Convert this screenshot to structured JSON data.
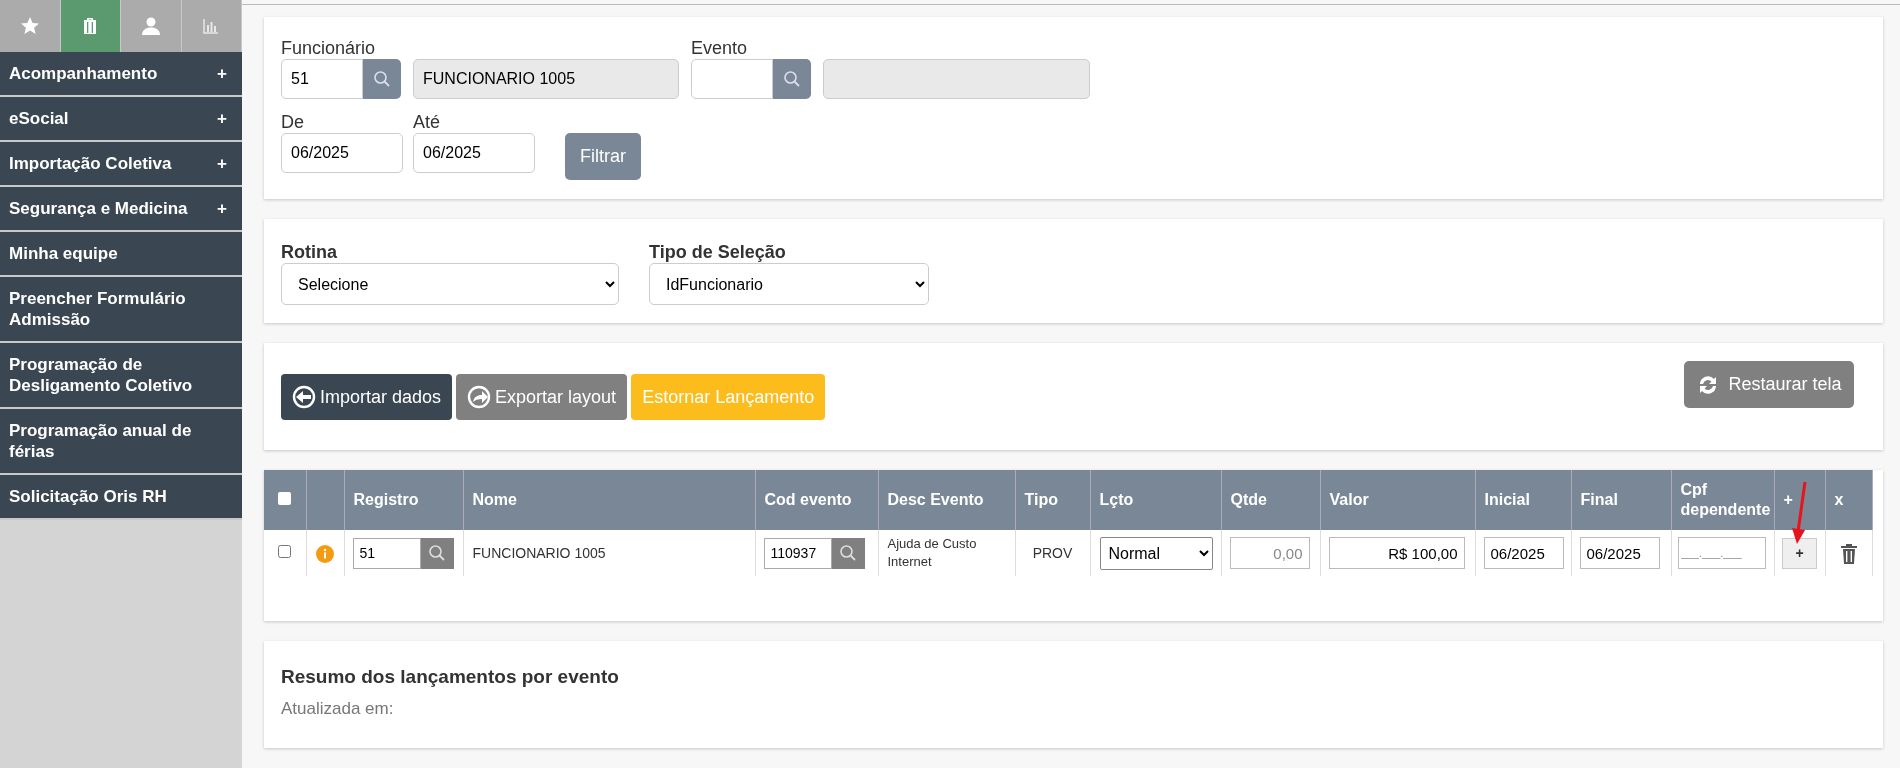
{
  "sidebar": {
    "tabs": [
      {
        "selected": false
      },
      {
        "selected": true
      },
      {
        "selected": false
      },
      {
        "selected": false
      }
    ],
    "items": [
      {
        "label": "Acompanhamento",
        "toggle": "+"
      },
      {
        "label": "eSocial",
        "toggle": "+"
      },
      {
        "label": "Importação Coletiva",
        "toggle": "+"
      },
      {
        "label": "Segurança e Medicina",
        "toggle": "+"
      },
      {
        "label": "Minha equipe"
      },
      {
        "label": "Preencher Formulário Admissão"
      },
      {
        "label": "Programação de Desligamento Coletivo"
      },
      {
        "label": "Programação anual de férias"
      },
      {
        "label": "Solicitação Oris RH"
      }
    ]
  },
  "filter": {
    "funcionario": {
      "label": "Funcionário",
      "value": "51",
      "name": "FUNCIONARIO 1005"
    },
    "evento": {
      "label": "Evento"
    },
    "de": {
      "label": "De",
      "value": "06/2025"
    },
    "ate": {
      "label": "Até",
      "value": "06/2025"
    },
    "button": "Filtrar"
  },
  "selection": {
    "rotina": {
      "label": "Rotina",
      "value": "Selecione"
    },
    "tipo": {
      "label": "Tipo de Seleção",
      "value": "IdFuncionario"
    }
  },
  "actions": [
    {
      "label": "Importar dados",
      "kind": "import"
    },
    {
      "label": "Exportar layout",
      "kind": "export"
    },
    {
      "label": "Estornar Lançamento",
      "kind": "reverse"
    }
  ],
  "restore_button": "Restaurar tela",
  "table": {
    "select_all_checked": false,
    "columns": [
      "Registro",
      "Nome",
      "Cod evento",
      "Desc Evento",
      "Tipo",
      "Lçto",
      "Qtde",
      "Valor",
      "Inicial",
      "Final",
      "Cpf dependente",
      "+",
      "x"
    ],
    "rows": [
      {
        "checked": false,
        "registro": "51",
        "nome": "FUNCIONARIO 1005",
        "cod_evento": "110937",
        "desc_evento": "Ajuda de Custo Internet",
        "tipo": "PROV",
        "lcto": "Normal",
        "qtde": {
          "placeholder": "0,00"
        },
        "valor": "R$ 100,00",
        "inicial": "06/2025",
        "final": "06/2025",
        "cpf": {
          "placeholder": "___.___.___"
        },
        "add": "+"
      }
    ]
  },
  "summary": {
    "title": "Resumo dos lançamentos por evento",
    "updated": "Atualizada em:"
  }
}
